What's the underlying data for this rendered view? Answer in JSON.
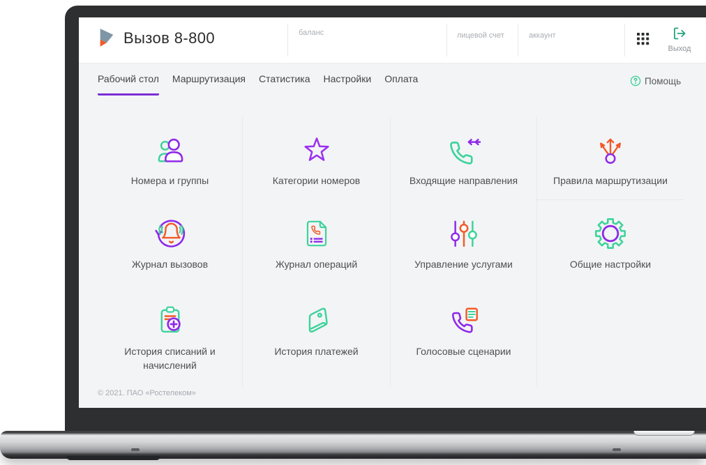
{
  "app": {
    "title": "Вызов 8-800"
  },
  "header": {
    "balance_label": "баланс",
    "personal_account_label": "лицевой счет",
    "account_label": "аккаунт",
    "logout_label": "Выход"
  },
  "nav": {
    "tabs": [
      {
        "label": "Рабочий стол",
        "active": true
      },
      {
        "label": "Маршрутизация",
        "active": false
      },
      {
        "label": "Статистика",
        "active": false
      },
      {
        "label": "Настройки",
        "active": false
      },
      {
        "label": "Оплата",
        "active": false
      }
    ],
    "help_label": "Помощь"
  },
  "tiles": [
    {
      "label": "Номера и группы",
      "icon": "people-icon"
    },
    {
      "label": "Категории номеров",
      "icon": "star-icon"
    },
    {
      "label": "Входящие направления",
      "icon": "phone-incoming-icon"
    },
    {
      "label": "Правила маршрутизации",
      "icon": "route-split-icon"
    },
    {
      "label": "Журнал вызовов",
      "icon": "call-log-icon"
    },
    {
      "label": "Журнал операций",
      "icon": "document-phone-icon"
    },
    {
      "label": "Управление услугами",
      "icon": "sliders-icon"
    },
    {
      "label": "Общие настройки",
      "icon": "gear-icon"
    },
    {
      "label": "История списаний и начислений",
      "icon": "clipboard-plus-icon"
    },
    {
      "label": "История платежей",
      "icon": "wallet-icon"
    },
    {
      "label": "Голосовые сценарии",
      "icon": "phone-script-icon"
    }
  ],
  "footer": {
    "copyright": "© 2021. ПАО «Ростелеком»"
  },
  "colors": {
    "purple": "#8e2ae8",
    "green": "#3ed39b",
    "orange": "#f25a29",
    "tab_underline": "#7c2fd4",
    "logout_teal": "#23a47e"
  }
}
